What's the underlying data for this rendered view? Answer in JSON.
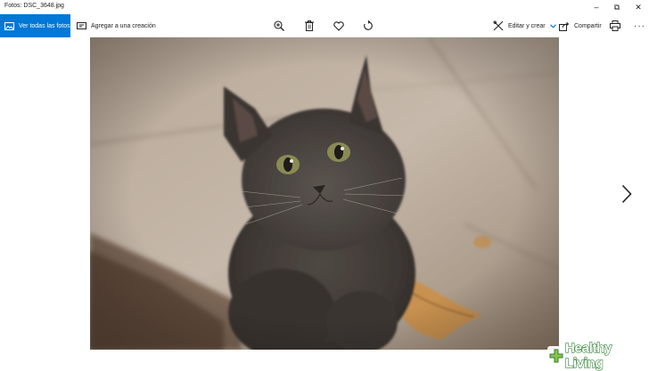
{
  "window": {
    "title": "Fotos: DSC_3648.jpg",
    "controls": {
      "minimize": "–",
      "restore": "⧉",
      "close": "✕"
    }
  },
  "toolbar": {
    "view_all": {
      "label": "Ver todas las fotos",
      "icon": "photos-icon"
    },
    "add_to_creation": {
      "label": "Agregar a una creación",
      "icon": "slideshow-icon"
    },
    "zoom": {
      "icon": "zoom-in-icon"
    },
    "delete": {
      "icon": "trash-icon"
    },
    "favorite": {
      "icon": "heart-icon"
    },
    "rotate": {
      "icon": "rotate-icon"
    },
    "edit_create": {
      "label": "Editar y crear",
      "icon": "edit-icon",
      "chevron": "chevron-down-icon"
    },
    "share": {
      "label": "Compartir",
      "icon": "share-icon"
    },
    "print": {
      "icon": "print-icon"
    },
    "more": {
      "label": "···",
      "icon": "more-icon"
    }
  },
  "viewer": {
    "image_subject": "kitten",
    "next": {
      "icon": "chevron-right-icon"
    }
  },
  "watermark": {
    "text": "Healthy Living",
    "icon": "plus-icon"
  },
  "colors": {
    "accent": "#0078d7",
    "watermark_green": "#2e7d32"
  }
}
